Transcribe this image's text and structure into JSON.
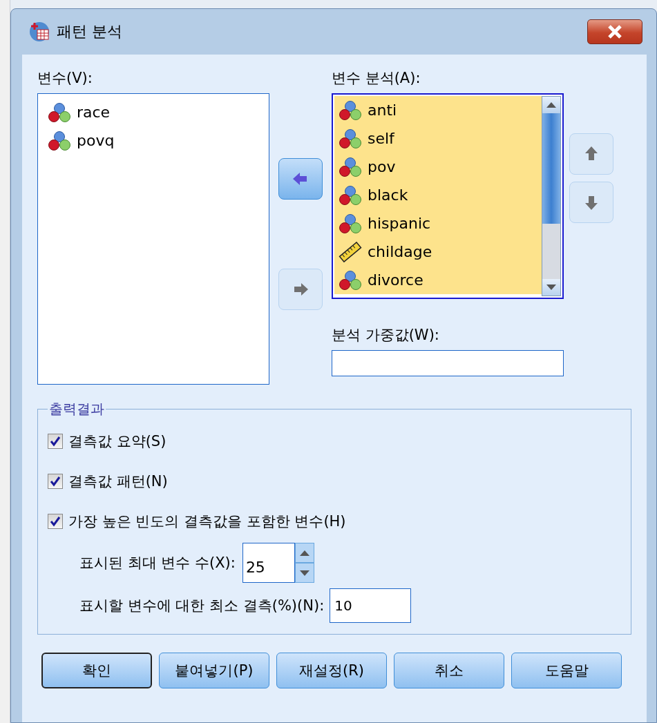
{
  "window": {
    "title": "패턴 분석"
  },
  "source": {
    "label": "변수(V):",
    "items": [
      {
        "name": "race",
        "kind": "nominal",
        "selected": false
      },
      {
        "name": "povq",
        "kind": "nominal",
        "selected": false
      }
    ]
  },
  "transfer_buttons": [
    {
      "disabled": false
    },
    {
      "disabled": true
    }
  ],
  "analysis": {
    "label": "변수 분석(A):",
    "items": [
      {
        "name": "anti",
        "kind": "nominal",
        "selected": true
      },
      {
        "name": "self",
        "kind": "nominal",
        "selected": true
      },
      {
        "name": "pov",
        "kind": "nominal",
        "selected": true
      },
      {
        "name": "black",
        "kind": "nominal",
        "selected": true
      },
      {
        "name": "hispanic",
        "kind": "nominal",
        "selected": true
      },
      {
        "name": "childage",
        "kind": "scale",
        "selected": true
      },
      {
        "name": "divorce",
        "kind": "nominal",
        "selected": true
      }
    ]
  },
  "order_buttons": [
    {
      "disabled": true
    },
    {
      "disabled": true
    }
  ],
  "weight": {
    "label": "분석 가중값(W):"
  },
  "output": {
    "legend": "출력결과",
    "options": [
      {
        "label": "결측값 요약(S)",
        "checked": true
      },
      {
        "label": "결측값 패턴(N)",
        "checked": true
      },
      {
        "label": "가장 높은 빈도의 결측값을 포함한 변수(H)",
        "checked": true
      }
    ],
    "max_vars": {
      "label": "표시된 최대 변수 수(X):",
      "value": "25"
    },
    "min_missing": {
      "label": "표시할 변수에 대한 최소 결측(%)(N):",
      "value": "10"
    }
  },
  "buttons": [
    {
      "label": "확인",
      "default": true
    },
    {
      "label": "붙여넣기(P)",
      "default": false
    },
    {
      "label": "재설정(R)",
      "default": false
    },
    {
      "label": "취소",
      "default": false
    },
    {
      "label": "도움말",
      "default": false
    }
  ]
}
